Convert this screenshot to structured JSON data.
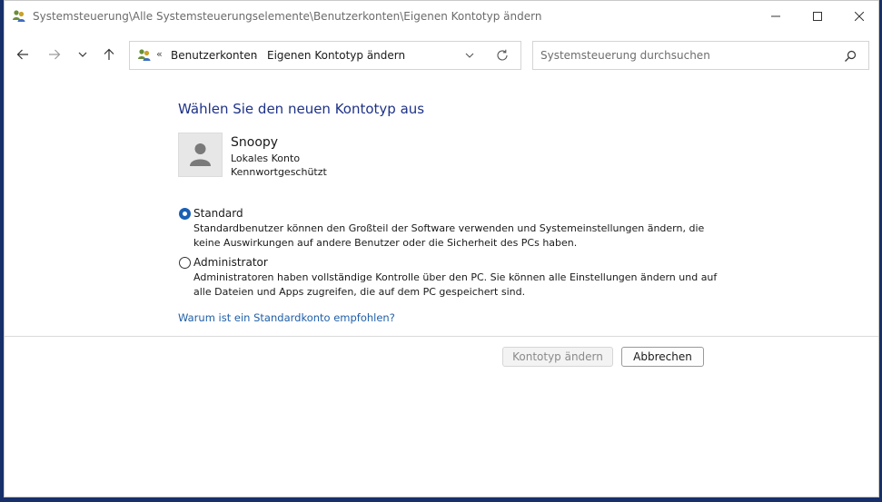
{
  "window": {
    "title": "Systemsteuerung\\Alle Systemsteuerungselemente\\Benutzerkonten\\Eigenen Kontotyp ändern"
  },
  "navigation": {
    "overflow_glyph": "«",
    "breadcrumbs": [
      "Benutzerkonten",
      "Eigenen Kontotyp ändern"
    ],
    "separator": "›"
  },
  "search": {
    "placeholder": "Systemsteuerung durchsuchen",
    "value": ""
  },
  "content": {
    "heading": "Wählen Sie den neuen Kontotyp aus",
    "user": {
      "name": "Snoopy",
      "type": "Lokales Konto",
      "password_status": "Kennwortgeschützt"
    },
    "options": [
      {
        "label": "Standard",
        "selected": true,
        "description": "Standardbenutzer können den Großteil der Software verwenden und Systemeinstellungen ändern, die keine Auswirkungen auf andere Benutzer oder die Sicherheit des PCs haben."
      },
      {
        "label": "Administrator",
        "selected": false,
        "description": "Administratoren haben vollständige Kontrolle über den PC. Sie können alle Einstellungen ändern und auf alle Dateien und Apps zugreifen, die auf dem PC gespeichert sind."
      }
    ],
    "help_link": "Warum ist ein Standardkonto empfohlen?"
  },
  "buttons": {
    "change": "Kontotyp ändern",
    "cancel": "Abbrechen"
  },
  "colors": {
    "heading": "#1e3287",
    "link": "#1f5fa8",
    "accent": "#1a5fb4"
  },
  "icons": {
    "app": "users-icon",
    "back": "arrow-left-icon",
    "forward": "arrow-right-icon",
    "recent": "chevron-down-icon",
    "up": "arrow-up-icon",
    "refresh": "refresh-icon",
    "search": "search-icon",
    "avatar": "user-silhouette-icon"
  }
}
